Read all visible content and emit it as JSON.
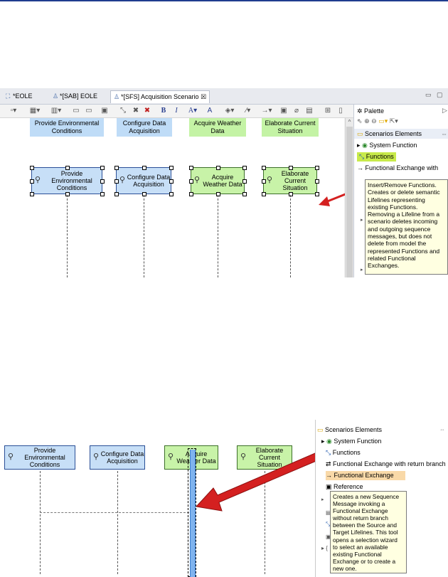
{
  "top": {
    "tabs": [
      {
        "label": "*EOLE",
        "icon": "system-icon"
      },
      {
        "label": "*[SAB] EOLE",
        "icon": "diagram-icon"
      },
      {
        "label": "*[SFS] Acquisition Scenario",
        "icon": "diagram-icon",
        "close": "☒"
      }
    ],
    "window_controls": [
      "▭",
      "▢"
    ],
    "headers": [
      {
        "label": "Provide Environmental Conditions",
        "color": "#bfdcf7"
      },
      {
        "label": "Configure Data Acquisition",
        "color": "#bfdcf7"
      },
      {
        "label": "Acquire Weather Data",
        "color": "#c4f3a5"
      },
      {
        "label": "Elaborate Current Situation",
        "color": "#c4f3a5"
      }
    ],
    "lifelines": [
      {
        "label": "Provide Environmental Conditions"
      },
      {
        "label": "Configure Data Acquisition"
      },
      {
        "label": "Acquire Weather Data"
      },
      {
        "label": "Elaborate Current Situation"
      }
    ],
    "palette": {
      "title": "Palette",
      "section": "Scenarios Elements",
      "items": [
        "System Function",
        "Functions",
        "Functional Exchange with"
      ],
      "selected": "Functions"
    },
    "tooltip": "Insert/Remove Functions. Creates or delete semantic Lifelines representing existing Functions. Removing a Lifeline from a scenario deletes incoming and outgoing sequence messages, but does not delete from model the represented Functions and related Functional Exchanges."
  },
  "bottom": {
    "lifelines": [
      {
        "label": "Provide Environmental Conditions",
        "color": "#bfdcf7"
      },
      {
        "label": "Configure Data Acquisition",
        "color": "#bfdcf7"
      },
      {
        "label": "Acquire Weather Data",
        "color": "#c4f3a5"
      },
      {
        "label": "Elaborate Current Situation",
        "color": "#c4f3a5"
      }
    ],
    "palette": {
      "section": "Scenarios Elements",
      "items": [
        "System Function",
        "Functions",
        "Functional Exchange with return branch",
        "Functional Exchange",
        "Reference"
      ],
      "selected": "Functional Exchange"
    },
    "tooltip": "Creates a new Sequence Message invoking a Functional Exchange without return branch between the Source and Target Lifelines. This tool opens a selection wizard to select an available existing Functional Exchange or to create a new one."
  },
  "colors": {
    "blue": "#bfdcf7",
    "green": "#c4f3a5",
    "arrow": "#d42020",
    "selected_top": "#c8ea4a",
    "selected_bottom": "#f9d9a8"
  }
}
